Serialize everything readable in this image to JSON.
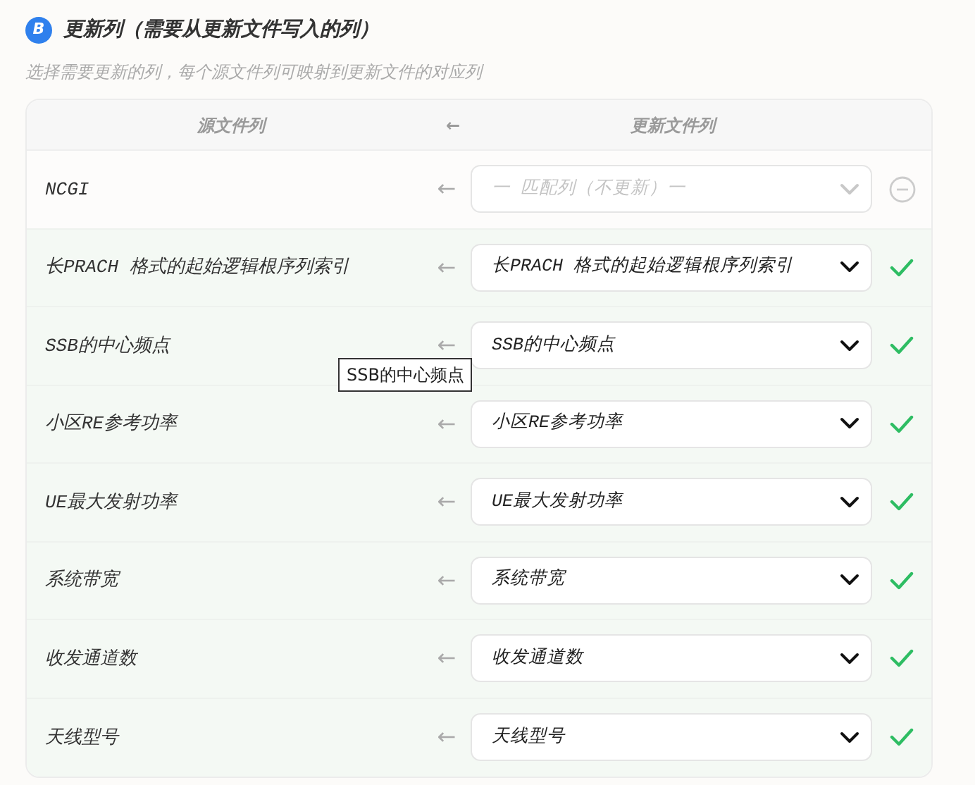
{
  "section": {
    "badge": "B",
    "title": "更新列（需要从更新文件写入的列）",
    "subtitle": "选择需要更新的列，每个源文件列可映射到更新文件的对应列"
  },
  "table": {
    "columns": [
      "源文件列",
      "←",
      "更新文件列"
    ],
    "rows": [
      {
        "source": "NCGI",
        "arrow": "←",
        "target": {
          "placeholder": "一 匹配列（不更新）一"
        },
        "matched": false
      },
      {
        "source": "长PRACH 格式的起始逻辑根序列索引",
        "arrow": "←",
        "target": {
          "value": "长PRACH 格式的起始逻辑根序列索引"
        },
        "matched": true
      },
      {
        "source": "SSB的中心频点",
        "arrow": "←",
        "target": {
          "value": "SSB的中心频点"
        },
        "matched": true,
        "tooltip": "SSB的中心频点"
      },
      {
        "source": "小区RE参考功率",
        "arrow": "←",
        "target": {
          "value": "小区RE参考功率"
        },
        "matched": true
      },
      {
        "source": "UE最大发射功率",
        "arrow": "←",
        "target": {
          "value": "UE最大发射功率"
        },
        "matched": true
      },
      {
        "source": "系统带宽",
        "arrow": "←",
        "target": {
          "value": "系统带宽"
        },
        "matched": true
      },
      {
        "source": "收发通道数",
        "arrow": "←",
        "target": {
          "value": "收发通道数"
        },
        "matched": true
      },
      {
        "source": "天线型号",
        "arrow": "←",
        "target": {
          "value": "天线型号"
        },
        "matched": true
      }
    ]
  }
}
